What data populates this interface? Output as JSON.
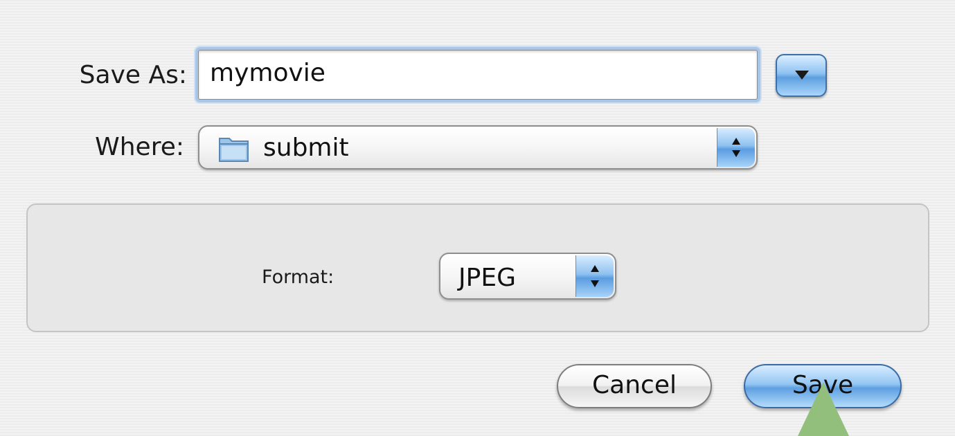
{
  "dialog": {
    "save_as_label": "Save As:",
    "filename_value": "mymovie",
    "where_label": "Where:",
    "where_value": "submit",
    "format_label": "Format:",
    "format_value": "JPEG",
    "cancel_label": "Cancel",
    "save_label": "Save"
  },
  "icons": {
    "expand": "triangle-down-icon",
    "folder": "folder-icon",
    "popup_arrows": "updown-arrows-icon"
  },
  "colors": {
    "accent": "#5e9fe0",
    "focus_ring": "#a9c6e6",
    "pointer": "#92bf7c"
  }
}
